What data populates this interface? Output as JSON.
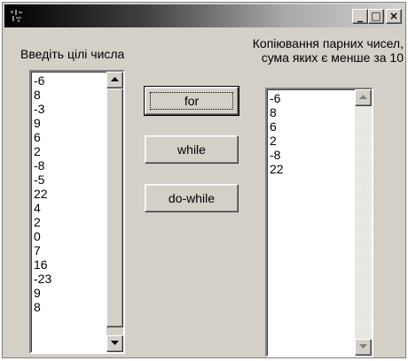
{
  "window": {
    "title": "",
    "buttons": {
      "minimize": "_",
      "maximize": "□",
      "close": "×"
    }
  },
  "left": {
    "label": "Введіть цілі числа",
    "items": [
      "-6",
      "8",
      "-3",
      "9",
      "6",
      "2",
      "-8",
      "-5",
      "22",
      "4",
      "2",
      "0",
      "7",
      "16",
      "-23",
      "9",
      "8"
    ]
  },
  "right": {
    "label_line1": "Копіювання парних чисел,",
    "label_line2": "сума яких є менше за 10",
    "items": [
      "-6",
      "8",
      "6",
      "2",
      "-8",
      "22"
    ]
  },
  "buttons": {
    "for": "for",
    "while": "while",
    "do_while": "do-while"
  },
  "colors": {
    "face": "#d4d0c8",
    "shadow": "#808080",
    "dark": "#404040",
    "highlight": "#ffffff"
  }
}
